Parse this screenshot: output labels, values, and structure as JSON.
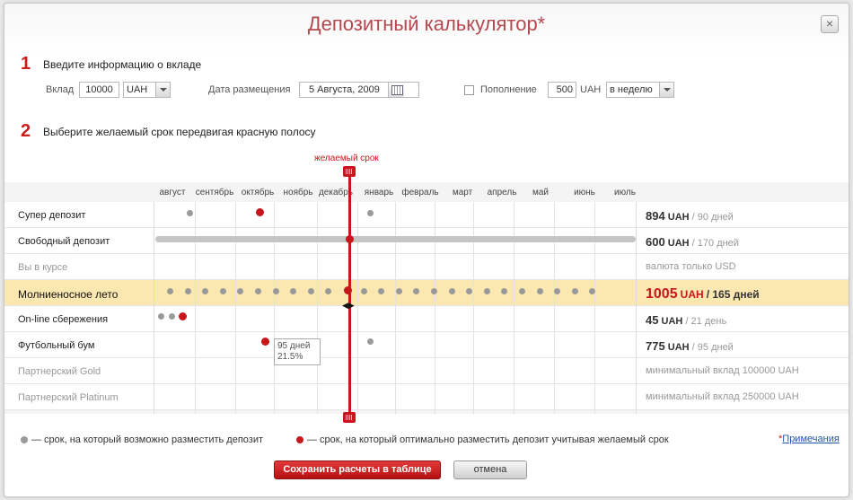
{
  "dialog": {
    "title": "Депозитный калькулятор*",
    "close_label": "×"
  },
  "step1": {
    "number": "1",
    "text": "Введите информацию о вкладе",
    "deposit_label": "Вклад",
    "deposit_value": "10000",
    "currency_value": "UAH",
    "date_label": "Дата размещения",
    "date_value": "5 Августа, 2009",
    "topup_label": "Пополнение",
    "topup_checked": false,
    "topup_value": "500",
    "topup_currency": "UAH",
    "topup_period": "в неделю"
  },
  "step2": {
    "number": "2",
    "text": "Выберите желаемый срок передвигая красную полосу"
  },
  "slider": {
    "label": "желаемый срок",
    "arrows": "◀▶"
  },
  "months": [
    "август",
    "сентябрь",
    "октябрь",
    "ноябрь",
    "декабрь",
    "январь",
    "февраль",
    "март",
    "апрель",
    "май",
    "июнь",
    "июль"
  ],
  "deposits": [
    {
      "name": "Супер депозит",
      "amount": "894",
      "currency": "UAH",
      "term": "/ 90 дней",
      "disabled": false
    },
    {
      "name": "Свободный депозит",
      "amount": "600",
      "currency": "UAH",
      "term": "/ 170 дней",
      "disabled": false
    },
    {
      "name": "Вы в курсе",
      "note": "валюта только USD",
      "disabled": true
    },
    {
      "name": "Молниеносное лето",
      "amount": "1005",
      "currency": "UAH",
      "term": "/ 165 дней",
      "disabled": false,
      "highlighted": true
    },
    {
      "name": "On-line сбережения",
      "amount": "45",
      "currency": "UAH",
      "term": "/ 21 день",
      "disabled": false
    },
    {
      "name": "Футбольный бум",
      "amount": "775",
      "currency": "UAH",
      "term": "/ 95 дней",
      "disabled": false
    },
    {
      "name": "Партнерский Gold",
      "note": "минимальный вклад 100000 UAH",
      "disabled": true
    },
    {
      "name": "Партнерский Platinum",
      "note": "минимальный вклад 250000 UAH",
      "disabled": true
    }
  ],
  "tooltip": {
    "days": "95 дней",
    "rate": "21.5%"
  },
  "legend": {
    "gray": "— срок, на который возможно разместить депозит",
    "red": "— срок, на который оптимально разместить депозит учитывая желаемый срок",
    "gray_color": "#9a9a9a",
    "red_color": "#c8161d"
  },
  "notes": {
    "asterisk": "*",
    "label": "Примечания"
  },
  "buttons": {
    "save": "Сохранить расчеты в таблице",
    "cancel": "отмена"
  }
}
